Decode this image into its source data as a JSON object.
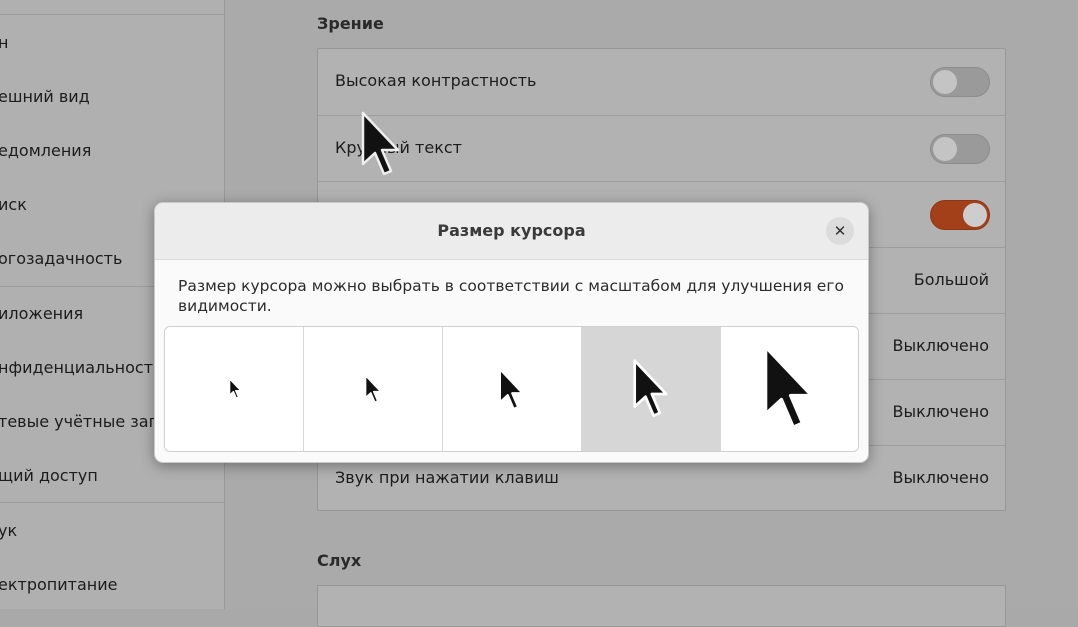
{
  "sidebar": {
    "items": [
      {
        "label": "н"
      },
      {
        "label": "ешний вид"
      },
      {
        "label": "едомления"
      },
      {
        "label": "иск"
      },
      {
        "label": "огозадачность"
      },
      {
        "label": "иложения"
      },
      {
        "label": "нфиденциальност"
      },
      {
        "label": "тевые учётные запи"
      },
      {
        "label": "щий доступ"
      },
      {
        "label": "ук"
      },
      {
        "label": "ектропитание"
      }
    ]
  },
  "main": {
    "vision_title": "Зрение",
    "hearing_title": "Слух",
    "rows": [
      {
        "label": "Высокая контрастность",
        "type": "toggle",
        "state": "off"
      },
      {
        "label": "Крупный текст",
        "type": "toggle",
        "state": "off"
      },
      {
        "label": "",
        "type": "toggle",
        "state": "on"
      },
      {
        "label": "",
        "value": "Большой"
      },
      {
        "label": "",
        "value": "Выключено"
      },
      {
        "label": "",
        "value": "Выключено"
      },
      {
        "label": "Звук при нажатии клавиш",
        "value": "Выключено"
      }
    ]
  },
  "dialog": {
    "title": "Размер курсора",
    "close_icon": "close-icon",
    "description": "Размер курсора можно выбрать в соответствии с масштабом для улучшения его видимости.",
    "options": [
      {
        "size_index": 1,
        "selected": false
      },
      {
        "size_index": 2,
        "selected": false
      },
      {
        "size_index": 3,
        "selected": false
      },
      {
        "size_index": 4,
        "selected": true
      },
      {
        "size_index": 5,
        "selected": false
      }
    ]
  },
  "colors": {
    "toggle_on": "#a3401a",
    "selected_option": "#d6d6d6"
  }
}
